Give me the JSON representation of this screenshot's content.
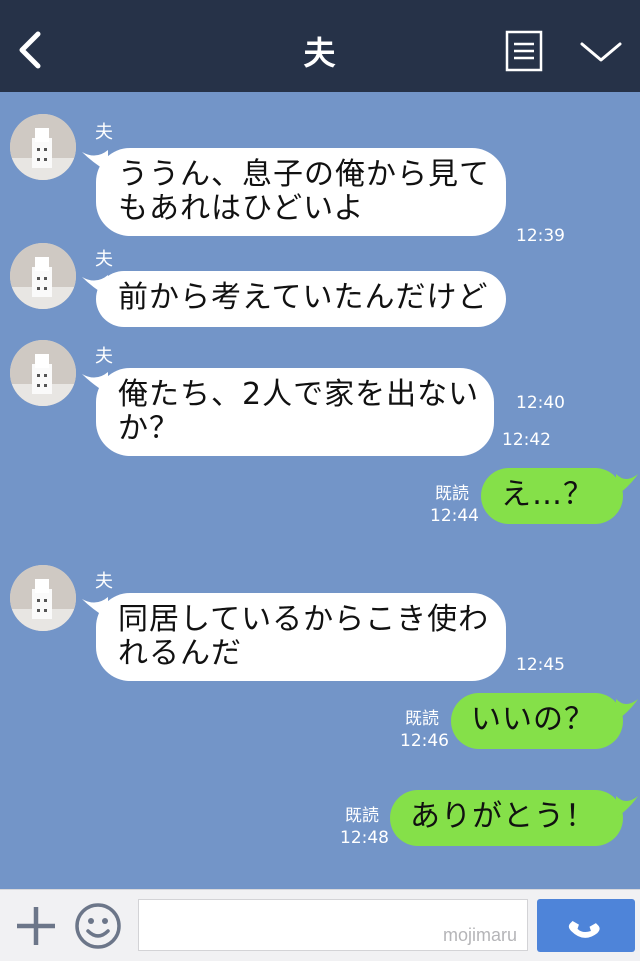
{
  "header": {
    "title": "夫"
  },
  "messages": [
    {
      "sender": "夫",
      "lines": [
        "ううん、息子の俺から見て",
        "もあれはひどいよ"
      ],
      "time": "12:39"
    },
    {
      "sender": "夫",
      "lines": [
        "前から考えていたんだけど"
      ],
      "time": "12:40"
    },
    {
      "sender": "夫",
      "lines": [
        "俺たち、2人で家を出ない",
        "か？"
      ],
      "time": "12:42"
    },
    {
      "out": true,
      "text": "え…？",
      "read": "既読",
      "time": "12:44"
    },
    {
      "sender": "夫",
      "lines": [
        "同居しているからこき使わ",
        "れるんだ"
      ],
      "time": "12:45"
    },
    {
      "out": true,
      "text": "いいの？",
      "read": "既読",
      "time": "12:46"
    },
    {
      "out": true,
      "text": "ありがとう！",
      "read": "既読",
      "time": "12:48"
    }
  ],
  "footer": {
    "watermark": "mojimaru"
  },
  "colors": {
    "header": "#263248",
    "chat_bg": "#7395c8",
    "outgoing_bubble": "#85e049",
    "incoming_bubble": "#ffffff",
    "call_button": "#4e84d9"
  },
  "icons": {
    "back": "chevron-left-icon",
    "menu": "note-icon",
    "collapse": "chevron-down-icon",
    "plus": "plus-icon",
    "emoji": "smile-icon",
    "call": "phone-icon"
  }
}
